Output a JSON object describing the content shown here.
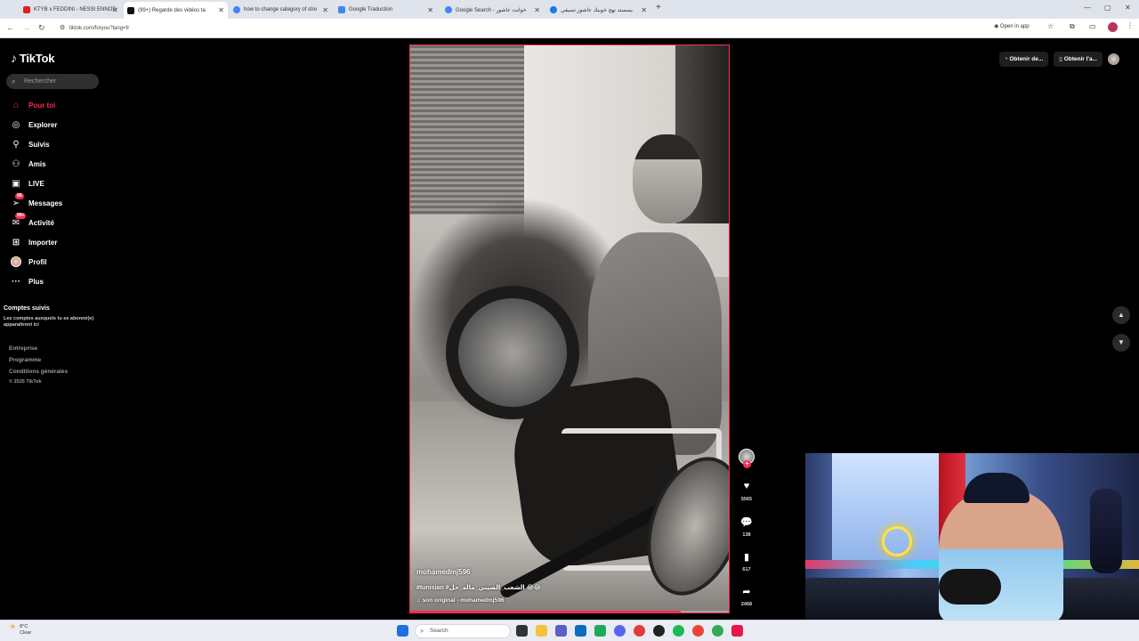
{
  "browser": {
    "tabs": [
      {
        "label": "KTYB x FEDDINI - NESSI ENNOD",
        "color": "#e02020"
      },
      {
        "label": "(99+) Regarde des vidéos ta",
        "color": "#111111"
      },
      {
        "label": "how to change category of stre",
        "color": "#4285f4"
      },
      {
        "label": "Google Traduction",
        "color": "#4285f4"
      },
      {
        "label": "Google Search - خوانت عاشور",
        "color": "#4285f4"
      },
      {
        "label": "يسستد نهج خوينك عاشور تسيفي",
        "color": "#1877f2"
      }
    ],
    "url": "tiktok.com/foryou?lang=fr",
    "open_in_app": "Open in app"
  },
  "tiktok": {
    "logo": "TikTok",
    "search_placeholder": "Rechercher",
    "nav": [
      {
        "label": "Pour toi",
        "icon": "home-icon"
      },
      {
        "label": "Explorer",
        "icon": "compass-icon"
      },
      {
        "label": "Suivis",
        "icon": "following-icon"
      },
      {
        "label": "Amis",
        "icon": "friends-icon"
      },
      {
        "label": "LIVE",
        "icon": "live-icon"
      },
      {
        "label": "Messages",
        "icon": "messages-icon",
        "badge": "99"
      },
      {
        "label": "Activité",
        "icon": "activity-icon",
        "badge": "99+"
      },
      {
        "label": "Importer",
        "icon": "upload-icon"
      },
      {
        "label": "Profil",
        "icon": "avatar"
      },
      {
        "label": "Plus",
        "icon": "more-icon"
      }
    ],
    "followed_title": "Comptes suivis",
    "followed_text": "Les comptes auxquels tu es abonné(e) apparaîtront ici",
    "footer": [
      "Entreprise",
      "Programme",
      "Conditions générales",
      "© 2025 TikTok"
    ],
    "top_right": {
      "get_app": "Obtenir de...",
      "get_desktop": "Obtenir l'a..."
    },
    "accent_color": "#fe2c55"
  },
  "video": {
    "username": "mohamedmj596",
    "caption": "#tunisian #الشعب_الصيني_ماله_حل 😂😂",
    "sound": "son original - mohamedmj596",
    "likes": "5565",
    "comments": "138",
    "saves": "617",
    "shares": "2468",
    "progress": 0.85
  },
  "taskbar": {
    "weather_temp": "8°C",
    "weather_desc": "Clear",
    "search_placeholder": "Search"
  }
}
